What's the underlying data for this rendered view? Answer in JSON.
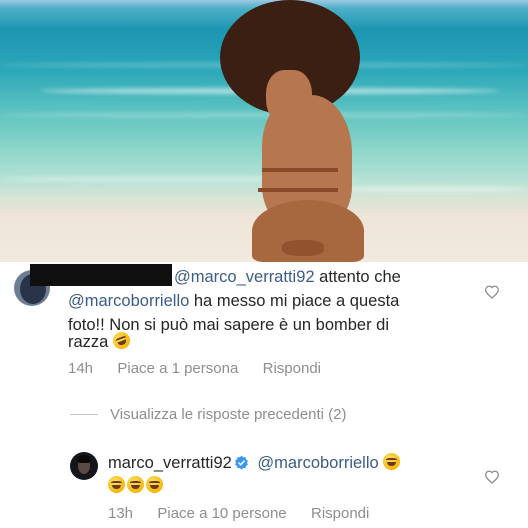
{
  "comment1": {
    "mention": "@marco_verratti92",
    "text_after_mention": " attento che",
    "mention2": "@marcoborriello",
    "text_line2": " ha messo mi piace a questa",
    "text_line3": "foto!! Non si può mai sapere è un bomber di",
    "text_line4": "razza",
    "time": "14h",
    "likes": "Piace a 1 persona",
    "reply": "Rispondi"
  },
  "view_replies": "Visualizza le risposte precedenti (2)",
  "comment2": {
    "username": "marco_verratti92",
    "mention": "@marcoborriello",
    "time": "13h",
    "likes": "Piace a 10 persone",
    "reply": "Rispondi"
  },
  "icons": {
    "like1": "heart-outline-icon",
    "like2": "heart-outline-icon",
    "verified": "verified-badge-icon",
    "emoji": "rolling-laughing-emoji",
    "emoji2": "tears-of-joy-emoji"
  },
  "colors": {
    "text": "#262626",
    "muted": "#8e8e8e",
    "mention": "#3b5b8a",
    "verified": "#3897f0"
  }
}
